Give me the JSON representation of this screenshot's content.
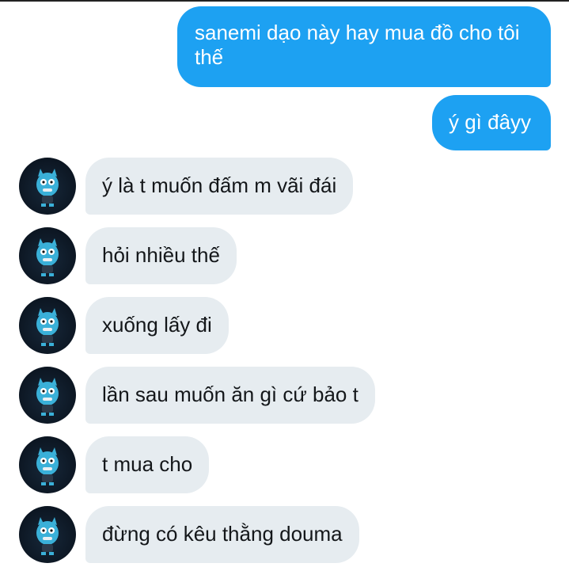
{
  "conversation": {
    "sent": [
      {
        "text": "sanemi dạo này hay mua đồ cho tôi thế"
      },
      {
        "text": "ý gì đâyy"
      }
    ],
    "received": [
      {
        "text": "ý là t muốn đấm m vãi đái"
      },
      {
        "text": "hỏi nhiều thế"
      },
      {
        "text": "xuống lấy đi"
      },
      {
        "text": "lần sau muốn ăn gì cứ bảo t"
      },
      {
        "text": "t mua cho"
      },
      {
        "text": "đừng có kêu thằng douma"
      }
    ]
  },
  "colors": {
    "sent_bubble": "#1da1f2",
    "received_bubble": "#e6ecf0",
    "avatar_bg": "#0c1622",
    "avatar_character": "#3ab0d8"
  },
  "icons": {
    "avatar": "cartoon-blue-cat-avatar-icon"
  }
}
